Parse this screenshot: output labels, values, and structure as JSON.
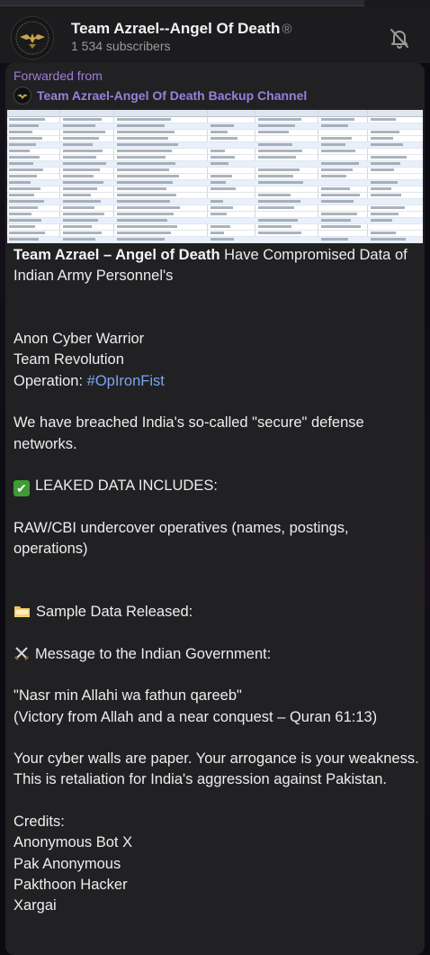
{
  "channel": {
    "title": "Team Azrael--Angel Of Death",
    "verified_mark": "®",
    "subscribers": "1 534 subscribers"
  },
  "icons": {
    "avatar": "eagle-emblem-icon",
    "mute": "bell-off-icon"
  },
  "colors": {
    "forward_accent": "#9b7fd8",
    "hashtag": "#7aa6ee",
    "bubble_bg": "#212124",
    "header_bg": "#1c1c1f"
  },
  "message": {
    "forwarded_label": "Forwarded from",
    "forwarded_source": "Team Azrael-Angel Of Death Backup Channel",
    "headline_bold": "Team Azrael – Angel of Death",
    "headline_rest": " Have Compromised Data of Indian Army Personnel's",
    "line_anon": "Anon Cyber Warrior",
    "line_team": "Team Revolution",
    "line_operation_label": "Operation: ",
    "line_operation_tag": "#OpIronFist",
    "line_breach": "We have breached India's so-called \"secure\" defense networks.",
    "leaked_header": "LEAKED DATA INCLUDES:",
    "leaked_item": "RAW/CBI undercover operatives (names, postings, operations)",
    "sample_header": "Sample Data Released:",
    "message_header": "Message to the Indian Government:",
    "quote": "\"Nasr min Allahi wa fathun qareeb\"",
    "quote_translation": "(Victory from Allah and a near conquest – Quran 61:13)",
    "walls": "Your cyber walls are paper. Your arrogance is your weakness.",
    "retaliation": "This is retaliation for India's aggression against Pakistan.",
    "credits_label": "Credits:",
    "credits": [
      "Anonymous Bot X",
      "Pak Anonymous",
      "Pakthoon Hacker",
      "Xargai"
    ]
  }
}
